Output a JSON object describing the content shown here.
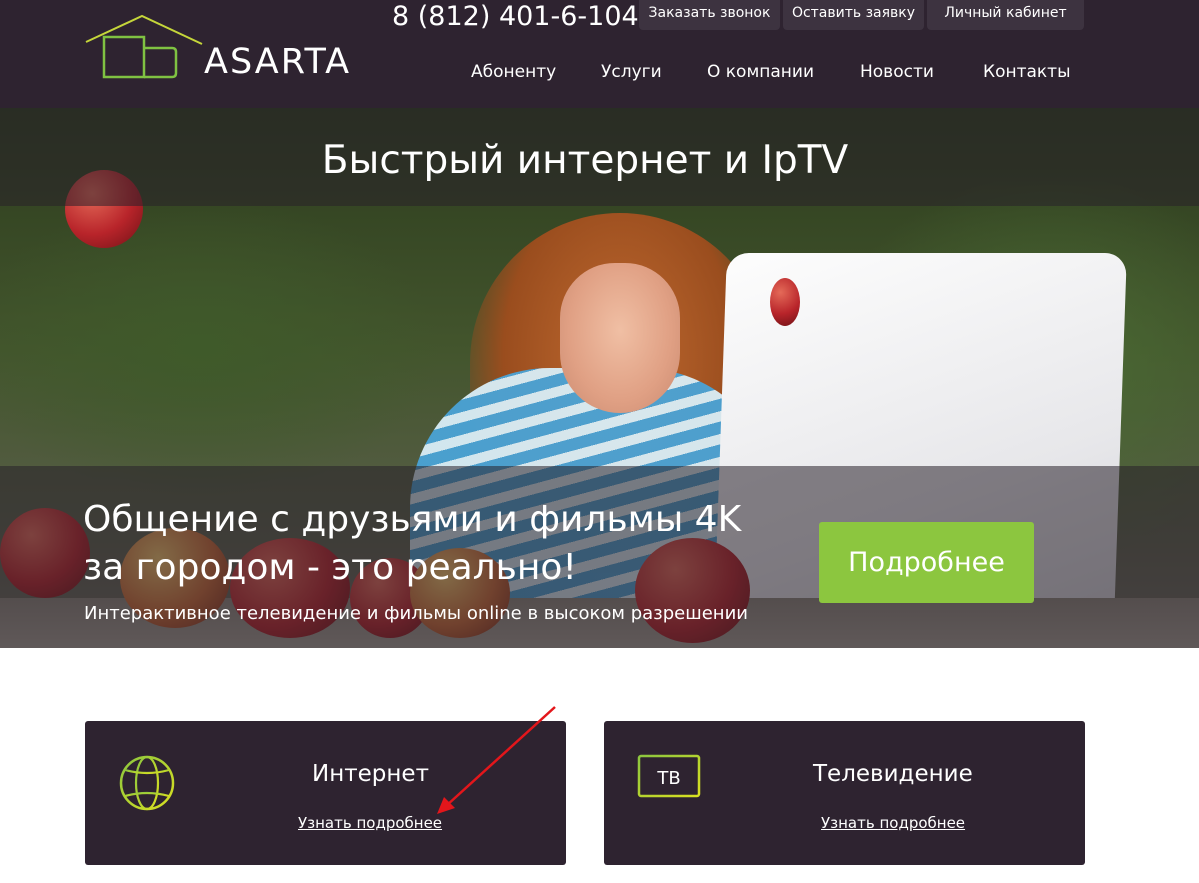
{
  "brand": {
    "logo_text": "ASARTA",
    "phone": "8 (812) 401-6-104"
  },
  "top_buttons": [
    {
      "label": "Заказать звонок"
    },
    {
      "label": "Оставить заявку"
    },
    {
      "label": "Личный кабинет"
    }
  ],
  "nav": [
    {
      "label": "Абоненту"
    },
    {
      "label": "Услуги"
    },
    {
      "label": "О компании"
    },
    {
      "label": "Новости"
    },
    {
      "label": "Контакты"
    }
  ],
  "hero": {
    "title": "Быстрый интернет и IpTV",
    "headline_line1": "Общение с друзьями и фильмы 4K",
    "headline_line2": "за городом - это реально!",
    "subtitle": "Интерактивное телевидение и фильмы online в высоком разрешении",
    "button_label": "Подробнее"
  },
  "cards": [
    {
      "title": "Интернет",
      "link": "Узнать подробнее",
      "icon": "globe-icon"
    },
    {
      "title": "Телевидение",
      "link": "Узнать подробнее",
      "icon": "tv-icon",
      "icon_text": "ТВ"
    }
  ],
  "colors": {
    "header_bg": "#2e2330",
    "accent_green": "#8cc63f",
    "logo_green": "#7fc242",
    "annotation_arrow": "#e3161b"
  }
}
